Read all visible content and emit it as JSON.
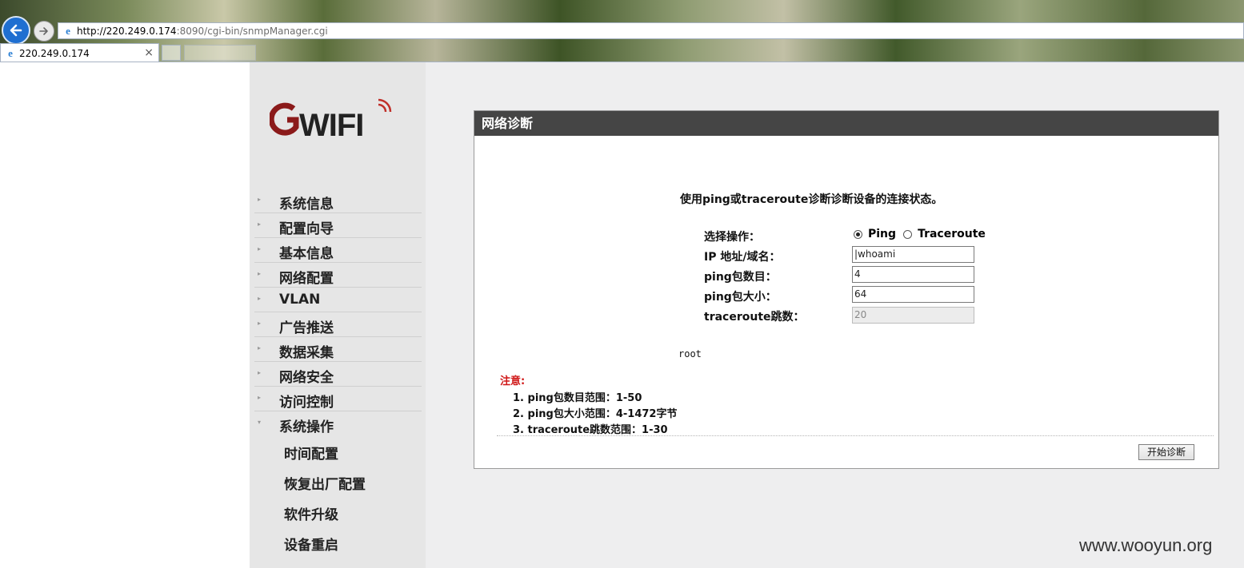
{
  "browser": {
    "address_host": "http://220.249.0.174",
    "address_rest": ":8090/cgi-bin/snmpManager.cgi",
    "tab_title": "220.249.0.174",
    "tab_close": "×"
  },
  "sidebar": {
    "logo_text": "GWIFI",
    "items": [
      {
        "label": "系统信息"
      },
      {
        "label": "配置向导"
      },
      {
        "label": "基本信息"
      },
      {
        "label": "网络配置"
      },
      {
        "label": "VLAN"
      },
      {
        "label": "广告推送"
      },
      {
        "label": "数据采集"
      },
      {
        "label": "网络安全"
      },
      {
        "label": "访问控制"
      },
      {
        "label": "系统操作"
      }
    ],
    "subitems": [
      {
        "label": "时间配置"
      },
      {
        "label": "恢复出厂配置"
      },
      {
        "label": "软件升级"
      },
      {
        "label": "设备重启"
      }
    ]
  },
  "panel": {
    "title": "网络诊断",
    "intro": "使用ping或traceroute诊断诊断设备的连接状态。",
    "operation_label": "选择操作：",
    "option_ping": "Ping",
    "option_traceroute": "Traceroute",
    "selected_option": "Ping",
    "ip_label": "IP 地址/域名：",
    "ip_value": "|whoami",
    "count_label": "ping包数目：",
    "count_value": "4",
    "size_label": "ping包大小：",
    "size_value": "64",
    "hops_label": "traceroute跳数：",
    "hops_value": "20",
    "result": "root",
    "note_title": "注意:",
    "notes": [
      "1. ping包数目范围：1-50",
      "2. ping包大小范围：4-1472字节",
      "3. traceroute跳数范围：1-30"
    ],
    "start_button": "开始诊断"
  },
  "watermark": "www.wooyun.org",
  "colors": {
    "panel_header": "#454545",
    "note_red": "#d01818",
    "sidebar_bg": "#e6e6e6",
    "content_bg": "#eeeeef",
    "logo_red": "#8b1a1a",
    "logo_dark": "#222222"
  }
}
